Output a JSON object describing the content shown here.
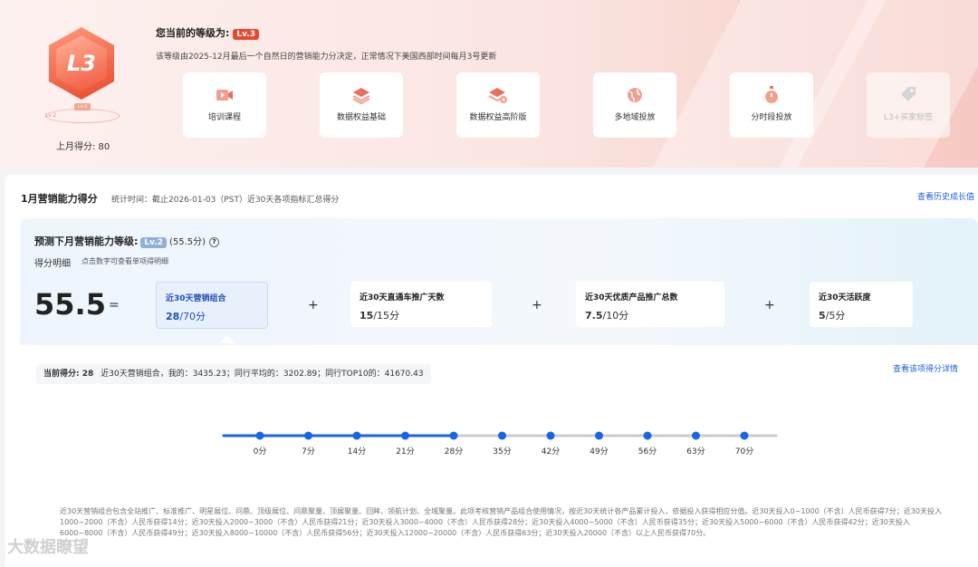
{
  "header": {
    "badge_level": "L3",
    "badge_ribbon": "Lv.3",
    "badge_prev": "Lv.2",
    "last_month_label": "上月得分: 80",
    "current_level_title": "您当前的等级为:",
    "current_level_chip": "Lv.3",
    "description": "该等级由2025-12月最后一个自然日的营销能力分决定，正常情况下美国西部时间每月3号更新",
    "cards": [
      {
        "label": "培训课程",
        "icon": "video-icon",
        "disabled": false
      },
      {
        "label": "数据权益基础",
        "icon": "layers-icon",
        "disabled": false
      },
      {
        "label": "数据权益高阶版",
        "icon": "layers-settings-icon",
        "disabled": false
      },
      {
        "label": "多地域投放",
        "icon": "globe-icon",
        "disabled": false
      },
      {
        "label": "分时段投放",
        "icon": "stopwatch-icon",
        "disabled": false
      },
      {
        "label": "L3+买家标签",
        "icon": "tag-icon",
        "disabled": true
      }
    ]
  },
  "main": {
    "title": "1月营销能力得分",
    "subtitle": "统计时间：截止2026-01-03（PST）近30天各项指标汇总得分",
    "history_link": "查看历史成长值",
    "prediction": {
      "title": "预测下月营销能力等级:",
      "level_chip": "Lv.2",
      "score": "(55.5分)",
      "detail_label": "得分明细",
      "detail_hint": "点击数字可查看单项得明细",
      "total": "55.5",
      "equals": "=",
      "plus": "+",
      "items": [
        {
          "title": "近30天营销组合",
          "value": "28",
          "max": "/70分",
          "active": true
        },
        {
          "title": "近30天直通车推广天数",
          "value": "15",
          "max": "/15分",
          "active": false
        },
        {
          "title": "近30天优质产品推广总数",
          "value": "7.5",
          "max": "/10分",
          "active": false
        },
        {
          "title": "近30天活跃度",
          "value": "5",
          "max": "/5分",
          "active": false
        }
      ]
    },
    "current": {
      "label": "当前得分: 28",
      "text": "近30天营销组合，我的：3435.23；同行平均的：3202.89；同行TOP10的：41670.43"
    },
    "detail_link": "查看该项得分详情",
    "note": "近30天营销组合包含全站推广、标准推广、明星展位、问鼎、顶级展位、问鼎聚量、顶展聚量、回眸、领航计划、全域聚量。此项考核营销产品组合使用情况，按近30天统计各产品累计投入，依据投入获得相应分值。近30天投入0~1000（不含）人民币获得7分；近30天投入1000~2000（不含）人民币获得14分；近30天投入2000~3000（不含）人民币获得21分；近30天投入3000~4000（不含）人民币获得28分；近30天投入4000~5000（不含）人民币获得35分；近30天投入5000~6000（不含）人民币获得42分；近30天投入6000~8000（不含）人民币获得49分；近30天投入8000~10000（不含）人民币获得56分；近30天投入12000~20000（不含）人民币获得63分；近30天投入20000（不含）以上人民币获得70分。"
  },
  "scale": {
    "ticks": [
      "0分",
      "7分",
      "14分",
      "21分",
      "28分",
      "35分",
      "42分",
      "49分",
      "56分",
      "63分",
      "70分"
    ],
    "max": 70,
    "current": 28,
    "accent": "#1565e8",
    "track": "#cccccc"
  },
  "watermark": "大数据瞭望"
}
